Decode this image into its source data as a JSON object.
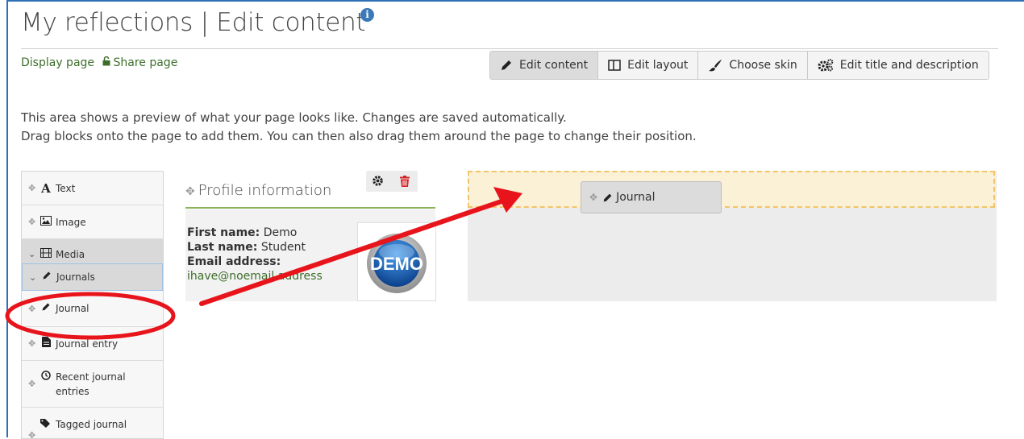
{
  "page": {
    "title": "My reflections | Edit content",
    "description_lines": [
      "This area shows a preview of what your page looks like. Changes are saved automatically.",
      "Drag blocks onto the page to add them. You can then also drag them around the page to change their position."
    ]
  },
  "links": {
    "display": "Display page",
    "share": "Share page"
  },
  "tabs": [
    {
      "label": "Edit content",
      "icon": "pencil-icon",
      "active": true
    },
    {
      "label": "Edit layout",
      "icon": "columns-icon",
      "active": false
    },
    {
      "label": "Choose skin",
      "icon": "paintbrush-icon",
      "active": false
    },
    {
      "label": "Edit title and description",
      "icon": "gears-icon",
      "active": false
    }
  ],
  "sidebar": {
    "items": [
      {
        "label": "Text",
        "icon": "text-icon"
      },
      {
        "label": "Image",
        "icon": "image-icon"
      },
      {
        "label": "Media",
        "icon": "film-icon",
        "category": true
      },
      {
        "label": "Journals",
        "icon": "pencil-icon",
        "category": true
      },
      {
        "label": "Journal",
        "icon": "pencil-icon"
      },
      {
        "label": "Journal entry",
        "icon": "file-icon"
      },
      {
        "label": "Recent journal entries",
        "icon": "clock-icon"
      },
      {
        "label": "Tagged journal",
        "icon": "tags-icon"
      }
    ]
  },
  "profile_block": {
    "title": "Profile information",
    "first_name_label": "First name:",
    "first_name": "Demo",
    "last_name_label": "Last name:",
    "last_name": "Student",
    "email_label": "Email address:",
    "email": "ihave@noemail.address",
    "avatar_text": "DEMO"
  },
  "drag_block": {
    "label": "Journal"
  },
  "colors": {
    "accent": "#3a78b8",
    "link": "#3c6e2a",
    "annotation": "#e8141b",
    "dropzone": "#f2c46b"
  }
}
